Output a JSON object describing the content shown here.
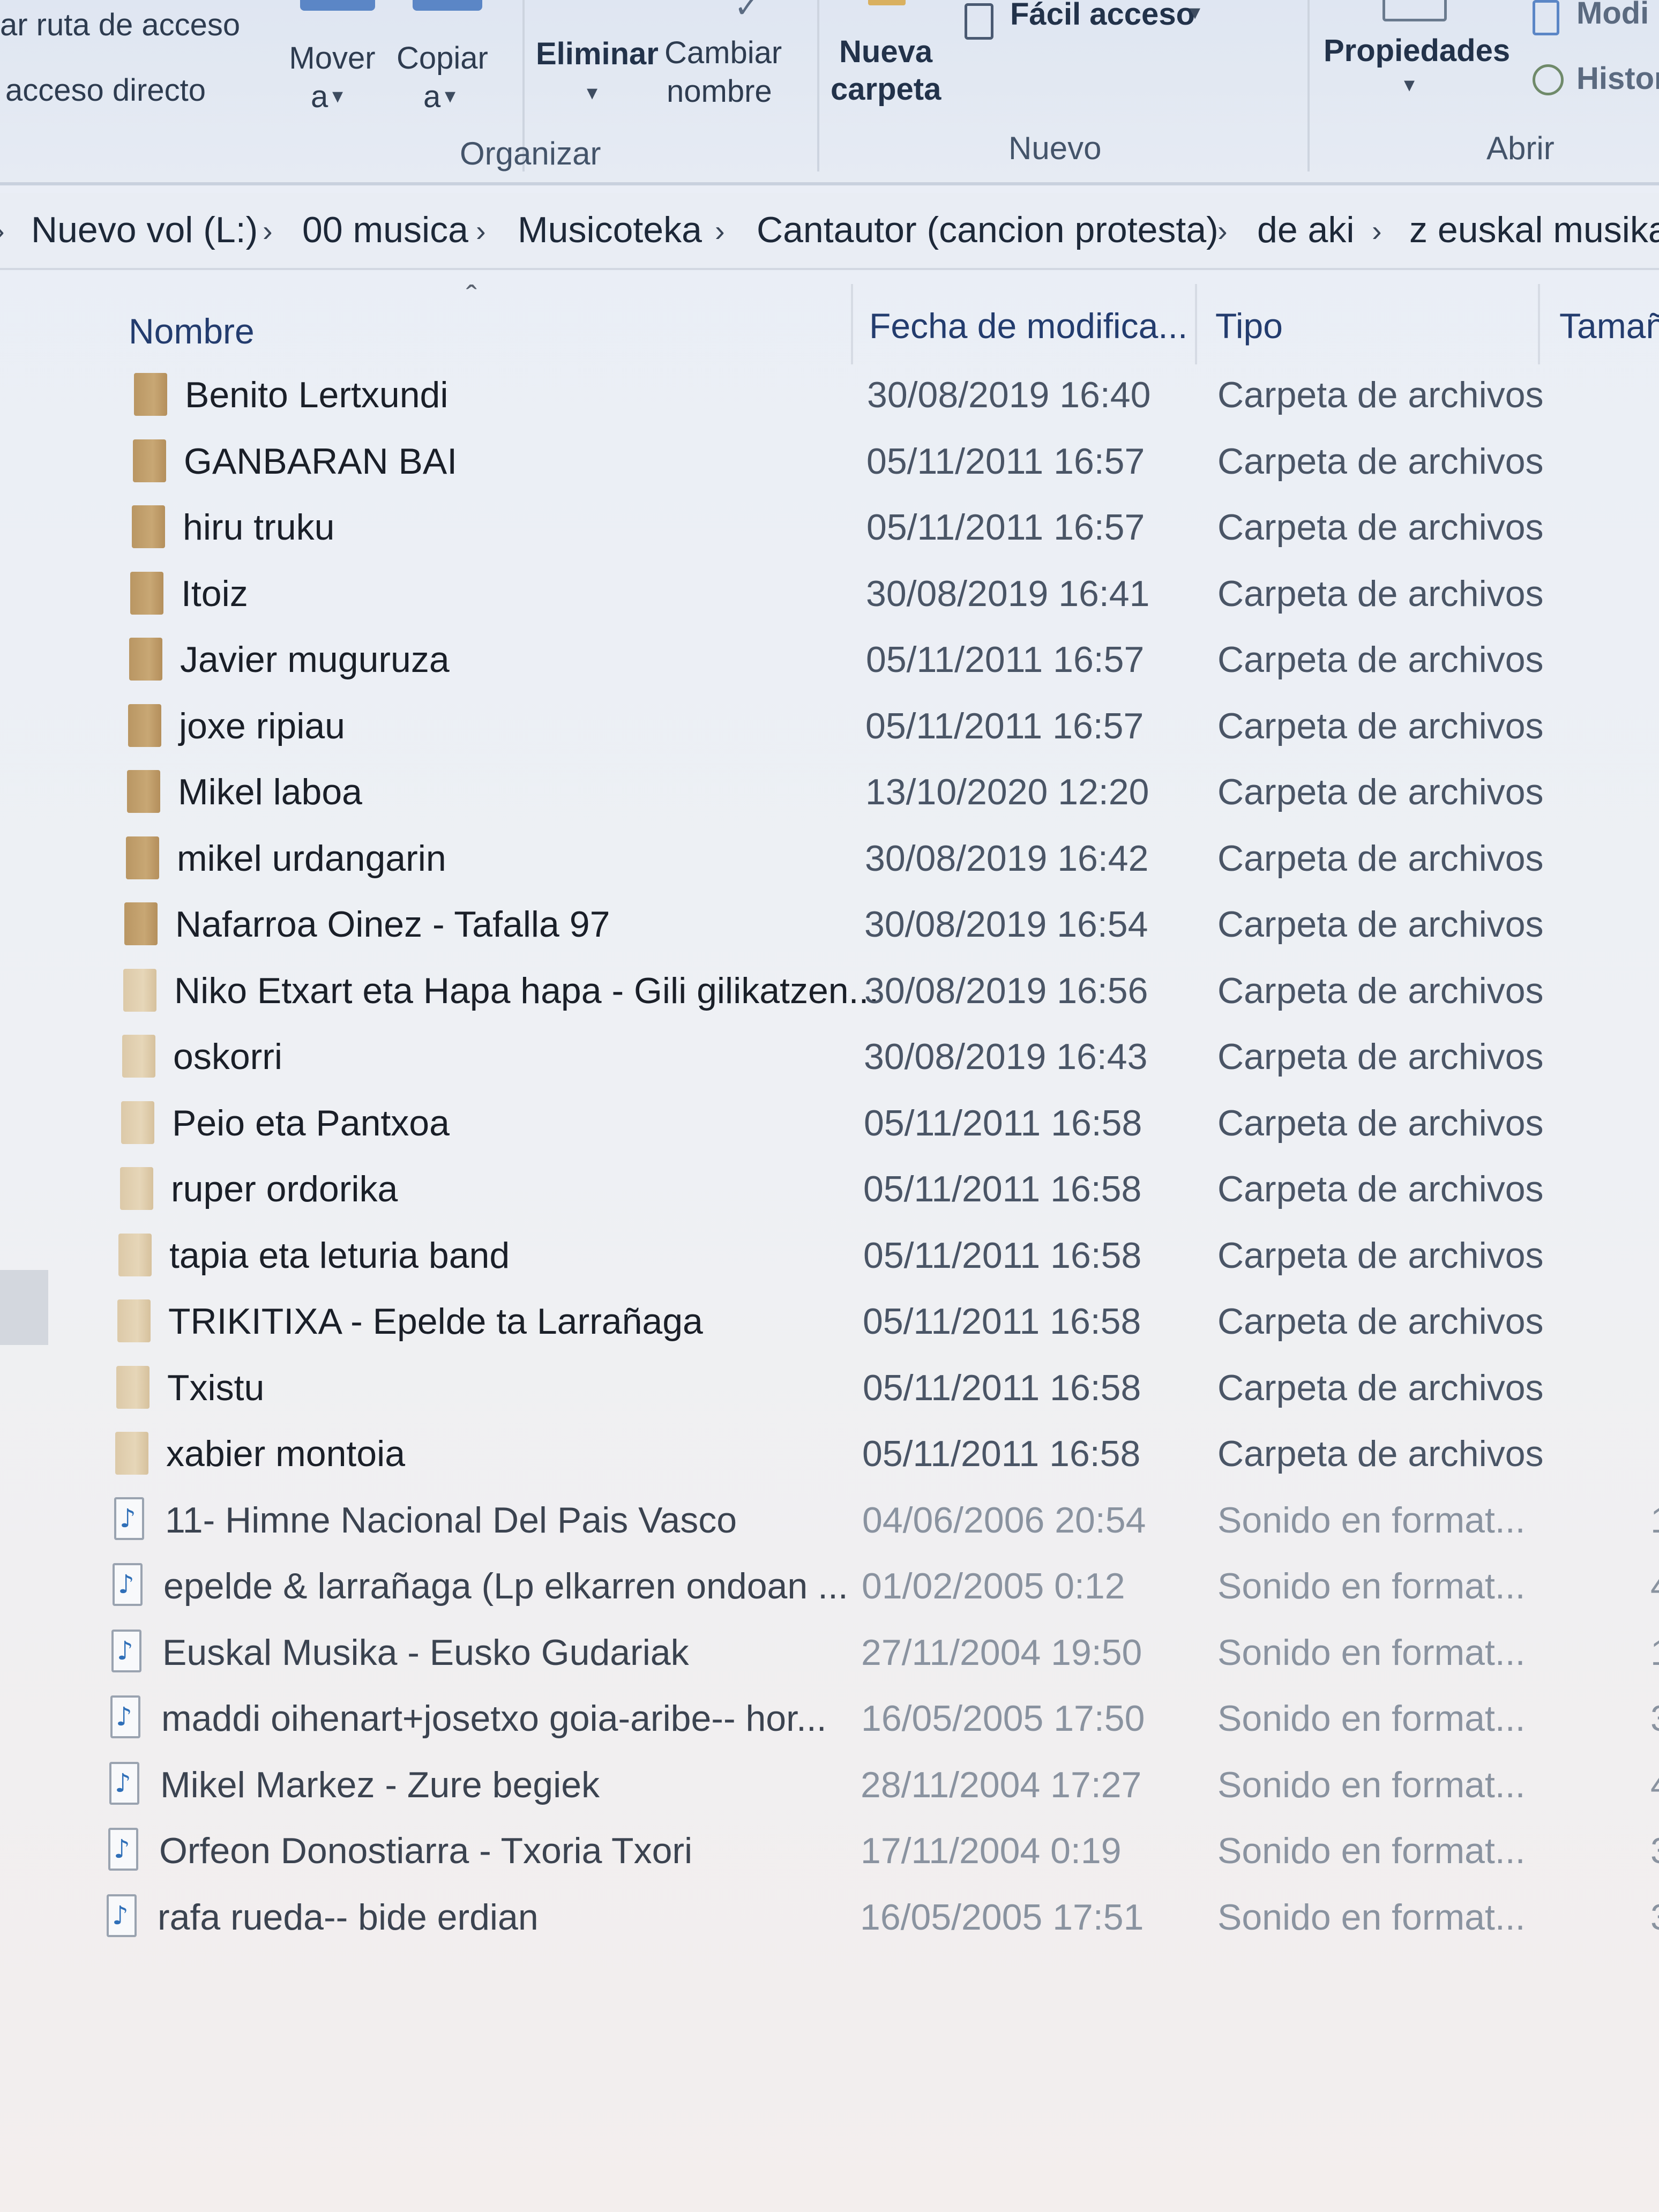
{
  "ribbon": {
    "copy_path_label": "ar ruta de acceso",
    "paste_shortcut_label": "acceso directo",
    "move_to": {
      "line1": "Mover",
      "line2": "a"
    },
    "copy_to": {
      "line1": "Copiar",
      "line2": "a"
    },
    "delete_label": "Eliminar",
    "rename": {
      "line1": "Cambiar",
      "line2": "nombre"
    },
    "new_folder": {
      "line1": "Nueva",
      "line2": "carpeta"
    },
    "easy_access_label": "Fácil acceso",
    "properties_label": "Propiedades",
    "modify_label": "Modi",
    "history_label": "Histor",
    "groups": {
      "organize": "Organizar",
      "new": "Nuevo",
      "open": "Abrir"
    }
  },
  "breadcrumb": {
    "items": [
      "Nuevo vol (L:)",
      "00 musica",
      "Musicoteka",
      "Cantautor (cancion protesta)",
      "de aki",
      "z euskal musika"
    ]
  },
  "columns": {
    "name": "Nombre",
    "date": "Fecha de modifica...",
    "type": "Tipo",
    "size": "Tamañ"
  },
  "files": [
    {
      "name": "Benito Lertxundi",
      "date": "30/08/2019 16:40",
      "type": "Carpeta de archivos",
      "size": "",
      "kind": "folder"
    },
    {
      "name": "GANBARAN BAI",
      "date": "05/11/2011 16:57",
      "type": "Carpeta de archivos",
      "size": "",
      "kind": "folder"
    },
    {
      "name": "hiru truku",
      "date": "05/11/2011 16:57",
      "type": "Carpeta de archivos",
      "size": "",
      "kind": "folder"
    },
    {
      "name": "Itoiz",
      "date": "30/08/2019 16:41",
      "type": "Carpeta de archivos",
      "size": "",
      "kind": "folder"
    },
    {
      "name": "Javier muguruza",
      "date": "05/11/2011 16:57",
      "type": "Carpeta de archivos",
      "size": "",
      "kind": "folder"
    },
    {
      "name": "joxe ripiau",
      "date": "05/11/2011 16:57",
      "type": "Carpeta de archivos",
      "size": "",
      "kind": "folder"
    },
    {
      "name": "Mikel laboa",
      "date": "13/10/2020 12:20",
      "type": "Carpeta de archivos",
      "size": "",
      "kind": "folder"
    },
    {
      "name": "mikel urdangarin",
      "date": "30/08/2019 16:42",
      "type": "Carpeta de archivos",
      "size": "",
      "kind": "folder"
    },
    {
      "name": "Nafarroa Oinez - Tafalla 97",
      "date": "30/08/2019 16:54",
      "type": "Carpeta de archivos",
      "size": "",
      "kind": "folder"
    },
    {
      "name": "Niko Etxart eta Hapa hapa - Gili gilikatzen...",
      "date": "30/08/2019 16:56",
      "type": "Carpeta de archivos",
      "size": "",
      "kind": "folder"
    },
    {
      "name": "oskorri",
      "date": "30/08/2019 16:43",
      "type": "Carpeta de archivos",
      "size": "",
      "kind": "folder"
    },
    {
      "name": "Peio eta Pantxoa",
      "date": "05/11/2011 16:58",
      "type": "Carpeta de archivos",
      "size": "",
      "kind": "folder"
    },
    {
      "name": "ruper ordorika",
      "date": "05/11/2011 16:58",
      "type": "Carpeta de archivos",
      "size": "",
      "kind": "folder"
    },
    {
      "name": "tapia eta leturia band",
      "date": "05/11/2011 16:58",
      "type": "Carpeta de archivos",
      "size": "",
      "kind": "folder"
    },
    {
      "name": "TRIKITIXA - Epelde ta Larrañaga",
      "date": "05/11/2011 16:58",
      "type": "Carpeta de archivos",
      "size": "",
      "kind": "folder"
    },
    {
      "name": "Txistu",
      "date": "05/11/2011 16:58",
      "type": "Carpeta de archivos",
      "size": "",
      "kind": "folder"
    },
    {
      "name": "xabier montoia",
      "date": "05/11/2011 16:58",
      "type": "Carpeta de archivos",
      "size": "",
      "kind": "folder"
    },
    {
      "name": "11- Himne Nacional Del Pais Vasco",
      "date": "04/06/2006 20:54",
      "type": "Sonido en format...",
      "size": "1.",
      "kind": "audio"
    },
    {
      "name": "epelde & larrañaga (Lp elkarren ondoan ...",
      "date": "01/02/2005 0:12",
      "type": "Sonido en format...",
      "size": "4.",
      "kind": "audio"
    },
    {
      "name": "Euskal Musika - Eusko Gudariak",
      "date": "27/11/2004 19:50",
      "type": "Sonido en format...",
      "size": "1.",
      "kind": "audio"
    },
    {
      "name": "maddi oihenart+josetxo goia-aribe-- hor...",
      "date": "16/05/2005 17:50",
      "type": "Sonido en format...",
      "size": "3.",
      "kind": "audio"
    },
    {
      "name": "Mikel Markez - Zure begiek",
      "date": "28/11/2004 17:27",
      "type": "Sonido en format...",
      "size": "4.",
      "kind": "audio"
    },
    {
      "name": "Orfeon Donostiarra - Txoria Txori",
      "date": "17/11/2004 0:19",
      "type": "Sonido en format...",
      "size": "3.",
      "kind": "audio"
    },
    {
      "name": "rafa rueda-- bide erdian",
      "date": "16/05/2005 17:51",
      "type": "Sonido en format...",
      "size": "3.",
      "kind": "audio"
    }
  ]
}
